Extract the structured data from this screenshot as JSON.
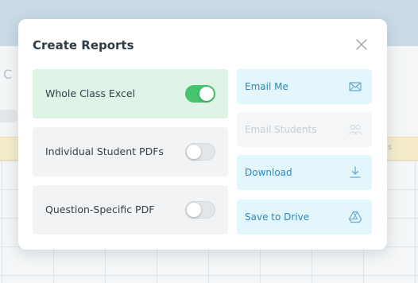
{
  "modal": {
    "title": "Create Reports"
  },
  "options": [
    {
      "label": "Whole Class Excel",
      "enabled": true
    },
    {
      "label": "Individual Student PDFs",
      "enabled": false
    },
    {
      "label": "Question-Specific PDF",
      "enabled": false
    }
  ],
  "actions": [
    {
      "label": "Email Me",
      "icon": "envelope-icon",
      "disabled": false
    },
    {
      "label": "Email Students",
      "icon": "group-icon",
      "disabled": true
    },
    {
      "label": "Download",
      "icon": "download-icon",
      "disabled": false
    },
    {
      "label": "Save to Drive",
      "icon": "drive-icon",
      "disabled": false
    }
  ],
  "colors": {
    "toggle_on": "#46c46e",
    "action_text": "#2b89c0",
    "action_bg": "#e3f6fb",
    "active_option_bg": "#dff3e6"
  }
}
